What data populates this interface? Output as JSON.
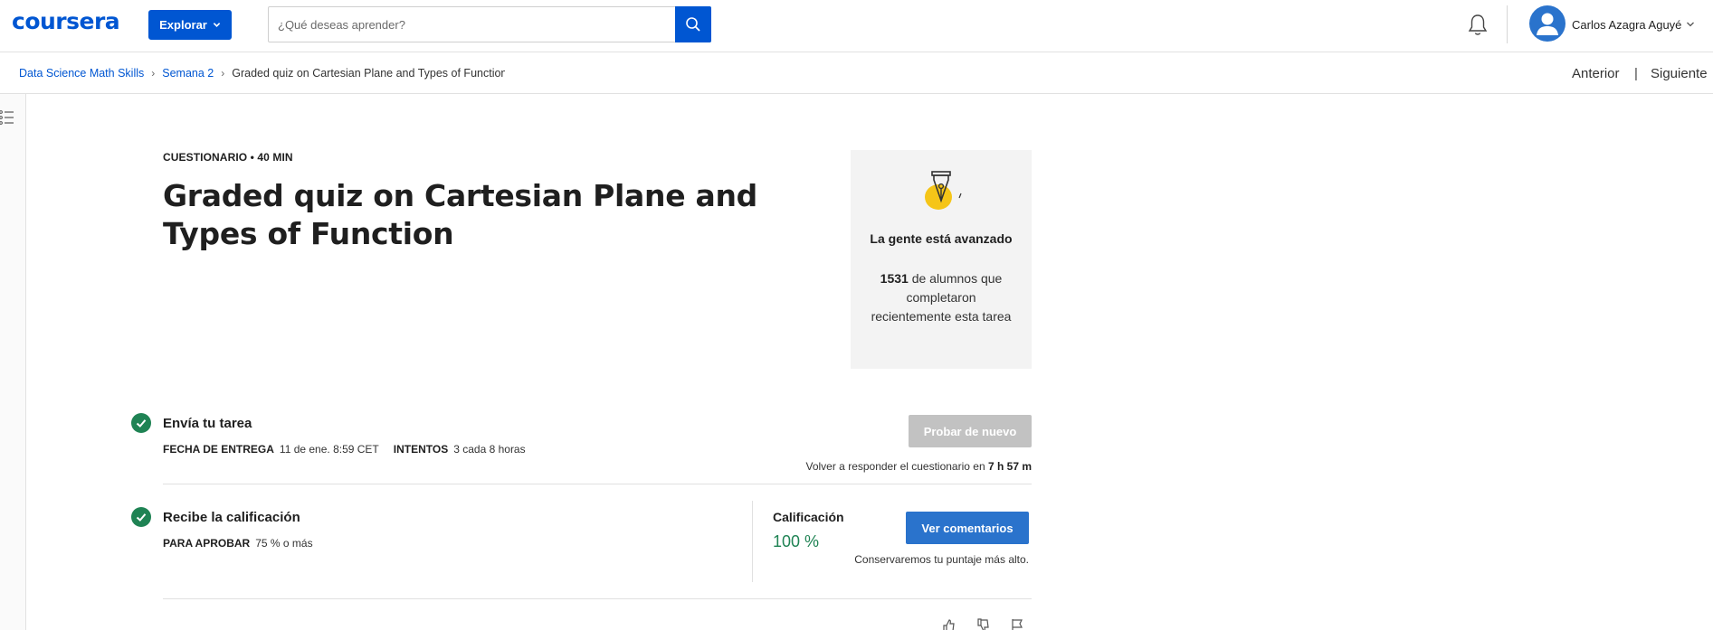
{
  "header": {
    "logo": "coursera",
    "explore_label": "Explorar",
    "search_placeholder": "¿Qué deseas aprender?",
    "user_name": "Carlos Azagra Aguyé"
  },
  "breadcrumb": {
    "items": [
      "Data Science Math Skills",
      "Semana 2"
    ],
    "current": "Graded quiz on Cartesian Plane and Types of Function",
    "prev_label": "Anterior",
    "divider": "|",
    "next_label": "Siguiente"
  },
  "quiz": {
    "meta": "CUESTIONARIO • 40 MIN",
    "title": "Graded quiz on Cartesian Plane and Types of Function"
  },
  "progress_card": {
    "headline": "La gente está avanzado",
    "count": "1531",
    "text": "de alumnos que completaron recientemente esta tarea"
  },
  "submit_step": {
    "title": "Envía tu tarea",
    "due_label": "FECHA DE ENTREGA",
    "due_value": "11 de ene. 8:59 CET",
    "attempts_label": "INTENTOS",
    "attempts_value": "3 cada 8 horas",
    "retry_label": "Probar de nuevo",
    "retry_note_prefix": "Volver a responder el cuestionario en",
    "retry_note_time": "7 h 57 m"
  },
  "grade_step": {
    "title": "Recibe la calificación",
    "pass_label": "PARA APROBAR",
    "pass_value": "75 % o más",
    "grade_label": "Calificación",
    "grade_value": "100 %",
    "comments_label": "Ver comentarios",
    "keep_note": "Conservaremos tu puntaje más alto."
  },
  "colors": {
    "brand_blue": "#0056d2",
    "button_blue": "#2a73cc",
    "success_green": "#1f8354",
    "disabled_gray": "#c2c2c2"
  }
}
